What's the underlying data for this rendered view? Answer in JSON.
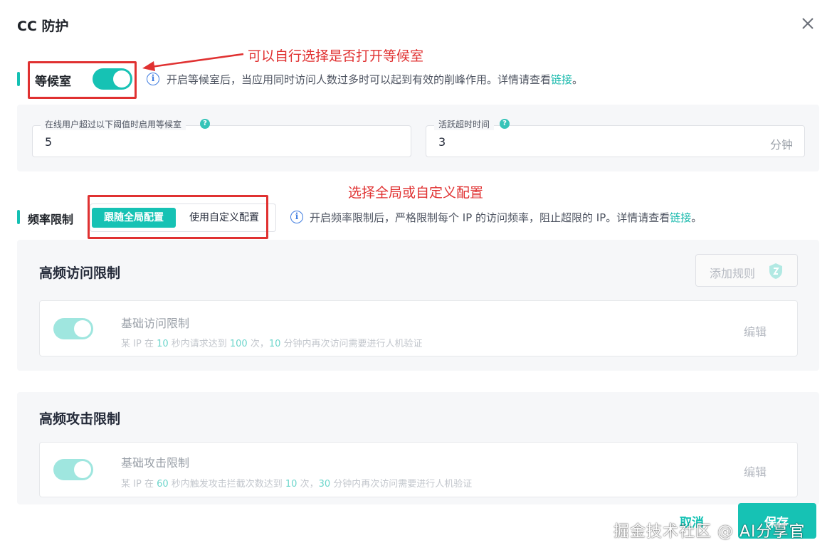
{
  "dialog": {
    "title": "CC 防护",
    "close_icon": "close-icon"
  },
  "waiting_room": {
    "label": "等候室",
    "enabled": true,
    "desc_prefix": "开启等候室后，当应用同时访问人数过多时可以起到有效的削峰作用。详情请查看",
    "desc_link": "链接",
    "desc_suffix": "。",
    "annotation": "可以自行选择是否打开等候室",
    "threshold": {
      "label": "在线用户超过以下阈值时启用等候室",
      "value": "5"
    },
    "timeout": {
      "label": "活跃超时时间",
      "value": "3",
      "unit": "分钟"
    }
  },
  "rate_limit": {
    "label": "频率限制",
    "annotation": "选择全局或自定义配置",
    "options": [
      "跟随全局配置",
      "使用自定义配置"
    ],
    "selected": "跟随全局配置",
    "desc_prefix": "开启频率限制后，严格限制每个 IP 的访问频率，阻止超限的 IP。详情请查看",
    "desc_link": "链接",
    "desc_suffix": "。"
  },
  "high_freq_access": {
    "title": "高频访问限制",
    "add_button": "添加规则",
    "rule": {
      "enabled": true,
      "title": "基础访问限制",
      "d1": "某 IP 在 ",
      "n1": "10",
      "d2": " 秒内请求达到 ",
      "n2": "100",
      "d3": " 次，",
      "n3": "10",
      "d4": " 分钟内再次访问需要进行人机验证",
      "edit": "编辑"
    }
  },
  "high_freq_attack": {
    "title": "高频攻击限制",
    "rule": {
      "enabled": true,
      "title": "基础攻击限制",
      "d1": "某 IP 在 ",
      "n1": "60",
      "d2": " 秒内触发攻击拦截次数达到 ",
      "n2": "10",
      "d3": " 次，",
      "n3": "30",
      "d4": " 分钟内再次访问需要进行人机验证",
      "edit": "编辑"
    }
  },
  "footer": {
    "cancel": "取消",
    "save": "保存",
    "watermark": "掘金技术社区 @ AI分享官"
  },
  "colors": {
    "accent": "#16c2b4",
    "annotation_red": "#e03131",
    "info_blue": "#3f7ce0"
  }
}
